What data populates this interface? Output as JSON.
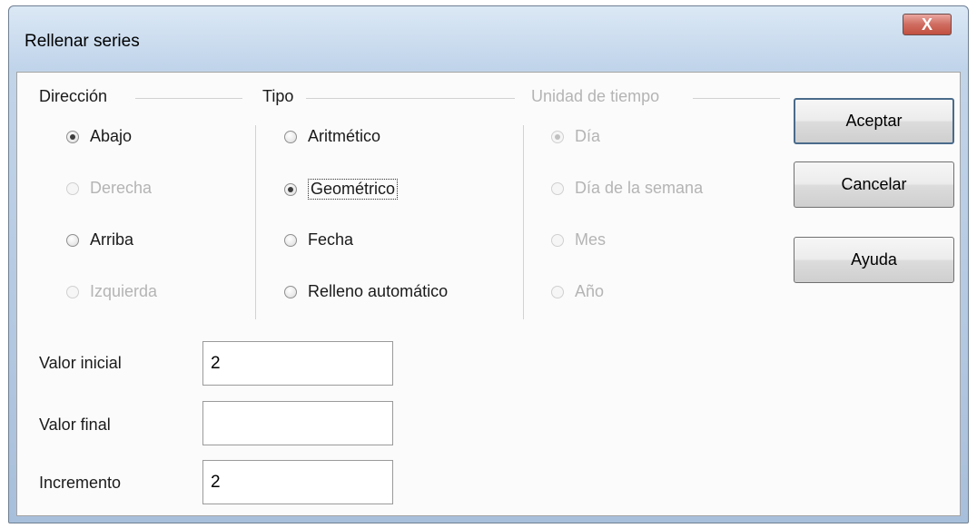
{
  "window": {
    "title": "Rellenar series",
    "close_label": "X"
  },
  "direccion": {
    "label": "Dirección",
    "options": [
      "Abajo",
      "Derecha",
      "Arriba",
      "Izquierda"
    ]
  },
  "tipo": {
    "label": "Tipo",
    "options": [
      "Aritmético",
      "Geométrico",
      "Fecha",
      "Relleno automático"
    ]
  },
  "unidad": {
    "label": "Unidad de tiempo",
    "options": [
      "Día",
      "Día de la semana",
      "Mes",
      "Año"
    ]
  },
  "buttons": {
    "ok": "Aceptar",
    "cancel": "Cancelar",
    "help": "Ayuda"
  },
  "fields": {
    "start": {
      "label": "Valor inicial",
      "value": "2"
    },
    "end": {
      "label": "Valor final",
      "value": ""
    },
    "increment": {
      "label": "Incremento",
      "value": "2"
    }
  }
}
